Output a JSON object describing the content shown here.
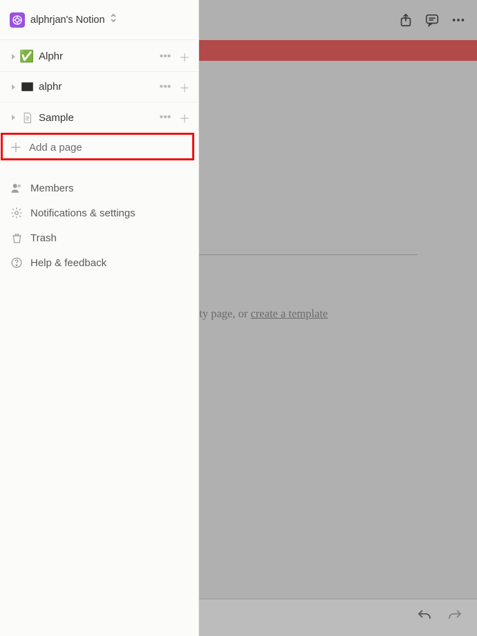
{
  "workspace": {
    "name": "alphrjan's Notion"
  },
  "pages": [
    {
      "icon": "✅",
      "label": "Alphr"
    },
    {
      "icon": "laptop",
      "label": "alphr"
    },
    {
      "icon": "doc",
      "label": "Sample"
    }
  ],
  "addPage": {
    "label": "Add a page"
  },
  "menu": {
    "members": "Members",
    "settings": "Notifications & settings",
    "trash": "Trash",
    "help": "Help & feedback"
  },
  "content": {
    "hintText": "pty page, or ",
    "hintLink": "create a template"
  }
}
